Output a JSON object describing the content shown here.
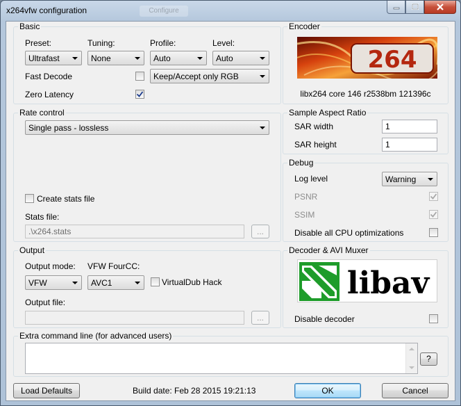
{
  "window": {
    "title": "x264vfw configuration",
    "ghost_tab": "Configure"
  },
  "basic": {
    "title": "Basic",
    "preset_label": "Preset:",
    "preset_value": "Ultrafast",
    "tuning_label": "Tuning:",
    "tuning_value": "None",
    "profile_label": "Profile:",
    "profile_value": "Auto",
    "level_label": "Level:",
    "level_value": "Auto",
    "fast_decode_label": "Fast Decode",
    "fast_decode_checked": false,
    "zero_latency_label": "Zero Latency",
    "zero_latency_checked": true,
    "colorspace_value": "Keep/Accept only RGB"
  },
  "encoder": {
    "title": "Encoder",
    "logo_text": "264",
    "version": "libx264 core 146 r2538bm 121396c"
  },
  "rate_control": {
    "title": "Rate control",
    "mode_value": "Single pass - lossless",
    "create_stats_label": "Create stats file",
    "create_stats_checked": false,
    "stats_file_label": "Stats file:",
    "stats_file_value": ".\\x264.stats",
    "browse_label": "..."
  },
  "sar": {
    "title": "Sample Aspect Ratio",
    "width_label": "SAR width",
    "width_value": "1",
    "height_label": "SAR height",
    "height_value": "1"
  },
  "debug": {
    "title": "Debug",
    "log_level_label": "Log level",
    "log_level_value": "Warning",
    "psnr_label": "PSNR",
    "psnr_checked": true,
    "ssim_label": "SSIM",
    "ssim_checked": true,
    "disable_cpu_label": "Disable all CPU optimizations",
    "disable_cpu_checked": false
  },
  "output": {
    "title": "Output",
    "mode_label": "Output mode:",
    "mode_value": "VFW",
    "fourcc_label": "VFW FourCC:",
    "fourcc_value": "AVC1",
    "virtualdub_label": "VirtualDub Hack",
    "virtualdub_checked": false,
    "file_label": "Output file:",
    "file_value": "",
    "browse_label": "..."
  },
  "decoder": {
    "title": "Decoder & AVI Muxer",
    "logo_text": "libav",
    "disable_decoder_label": "Disable decoder",
    "disable_decoder_checked": false
  },
  "extra": {
    "title": "Extra command line (for advanced users)",
    "value": "",
    "help_label": "?"
  },
  "footer": {
    "load_defaults_label": "Load Defaults",
    "build_date": "Build date: Feb 28 2015 19:21:13",
    "ok_label": "OK",
    "cancel_label": "Cancel"
  },
  "colors": {
    "window_frame": "#b4c7dc",
    "client_bg": "#f0f0f0",
    "close_button": "#c7503b",
    "libav_green": "#1e9c2a",
    "x264_orange": "#e8631c"
  }
}
